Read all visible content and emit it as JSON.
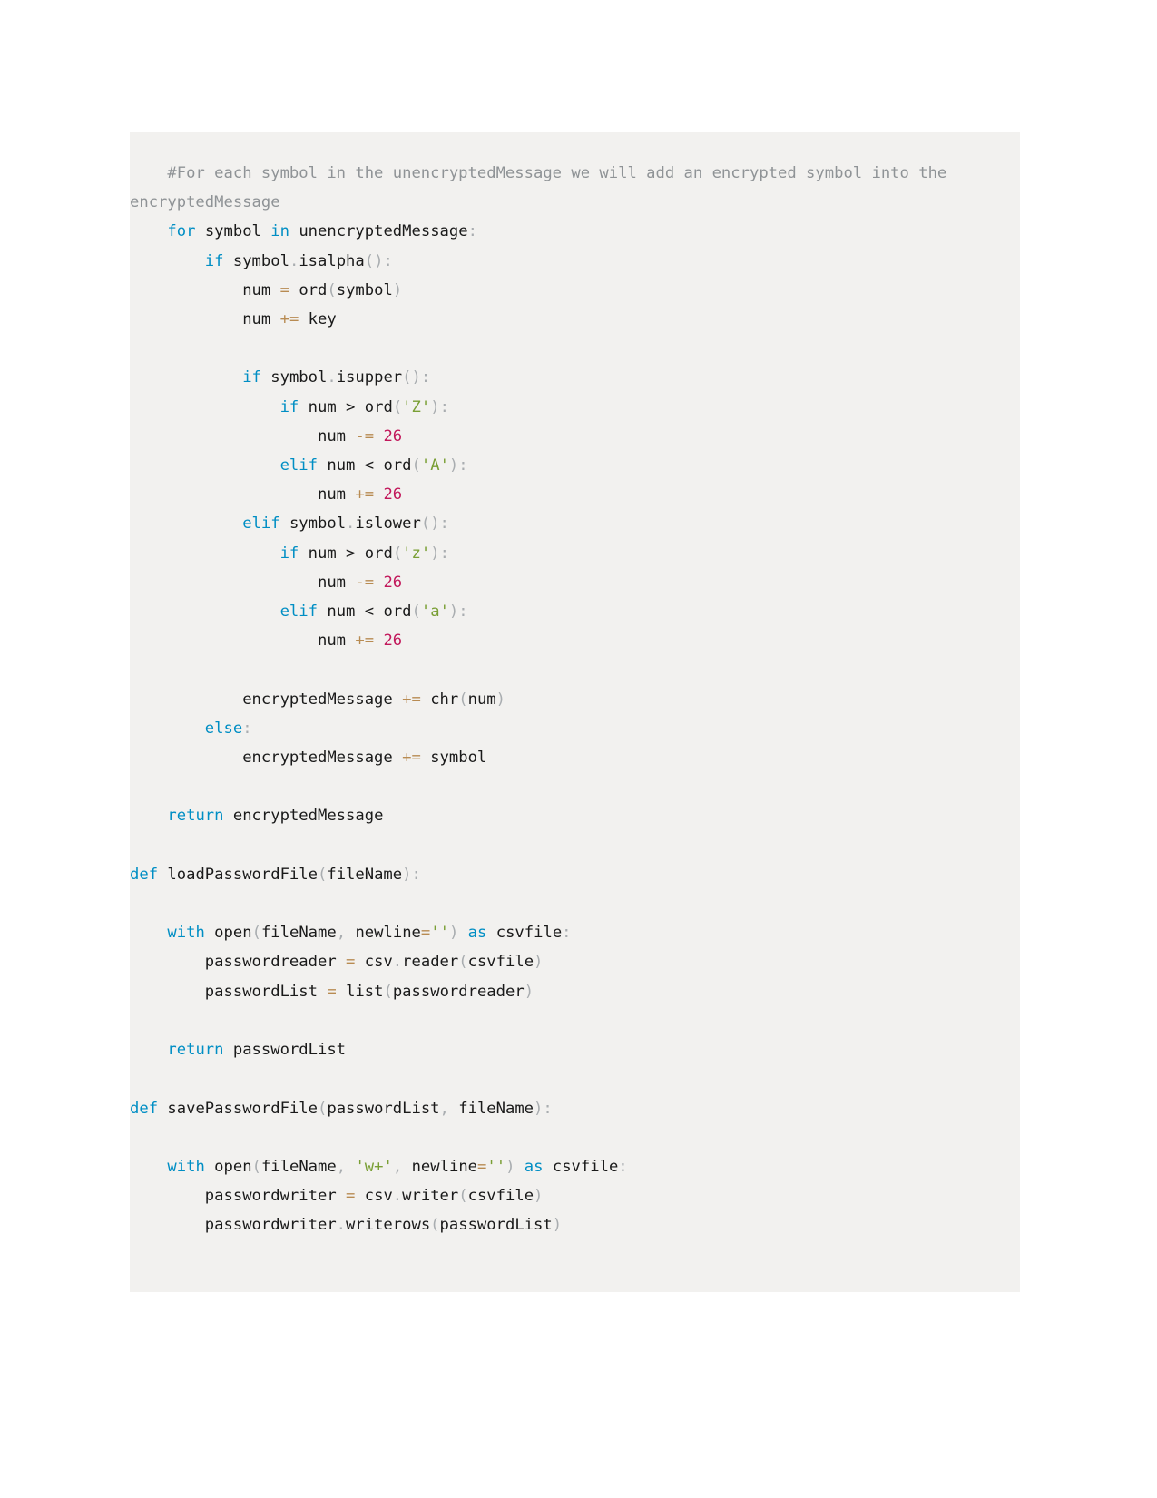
{
  "document": {
    "type": "code-listing",
    "language": "python",
    "page_background": "#ffffff",
    "code_background": "#f2f1ef"
  },
  "theme": {
    "keyword": "#008ec4",
    "comment": "#8f9396",
    "string": "#7a9f35",
    "number": "#c2185b",
    "operator": "#b88b52",
    "punctuation": "#a9adb0",
    "text": "#1a1a1a"
  },
  "code": {
    "lines": [
      "    #For each symbol in the unencryptedMessage we will add an encrypted symbol into the encryptedMessage",
      "    for symbol in unencryptedMessage:",
      "        if symbol.isalpha():",
      "            num = ord(symbol)",
      "            num += key",
      "",
      "            if symbol.isupper():",
      "                if num > ord('Z'):",
      "                    num -= 26",
      "                elif num < ord('A'):",
      "                    num += 26",
      "            elif symbol.islower():",
      "                if num > ord('z'):",
      "                    num -= 26",
      "                elif num < ord('a'):",
      "                    num += 26",
      "",
      "            encryptedMessage += chr(num)",
      "        else:",
      "            encryptedMessage += symbol",
      "",
      "    return encryptedMessage",
      "",
      "def loadPasswordFile(fileName):",
      "",
      "    with open(fileName, newline='') as csvfile:",
      "        passwordreader = csv.reader(csvfile)",
      "        passwordList = list(passwordreader)",
      "",
      "    return passwordList",
      "",
      "def savePasswordFile(passwordList, fileName):",
      "",
      "    with open(fileName, 'w+', newline='') as csvfile:",
      "        passwordwriter = csv.writer(csvfile)",
      "        passwordwriter.writerows(passwordList)"
    ],
    "comment_text": "#For each symbol in the unencryptedMessage we will add an encrypted symbol into the encryptedMessage",
    "keywords": [
      "for",
      "in",
      "if",
      "elif",
      "else",
      "def",
      "with",
      "as",
      "return"
    ],
    "string_literals": [
      "'Z'",
      "'A'",
      "'z'",
      "'a'",
      "''",
      "'w+'"
    ],
    "numbers": [
      "26"
    ],
    "identifiers": [
      "symbol",
      "unencryptedMessage",
      "num",
      "ord",
      "key",
      "isalpha",
      "isupper",
      "islower",
      "encryptedMessage",
      "chr",
      "loadPasswordFile",
      "fileName",
      "open",
      "newline",
      "csvfile",
      "passwordreader",
      "csv",
      "reader",
      "passwordList",
      "list",
      "savePasswordFile",
      "passwordwriter",
      "writer",
      "writerows"
    ],
    "functions": [
      {
        "name": "loadPasswordFile",
        "params": [
          "fileName"
        ]
      },
      {
        "name": "savePasswordFile",
        "params": [
          "passwordList",
          "fileName"
        ]
      }
    ]
  }
}
